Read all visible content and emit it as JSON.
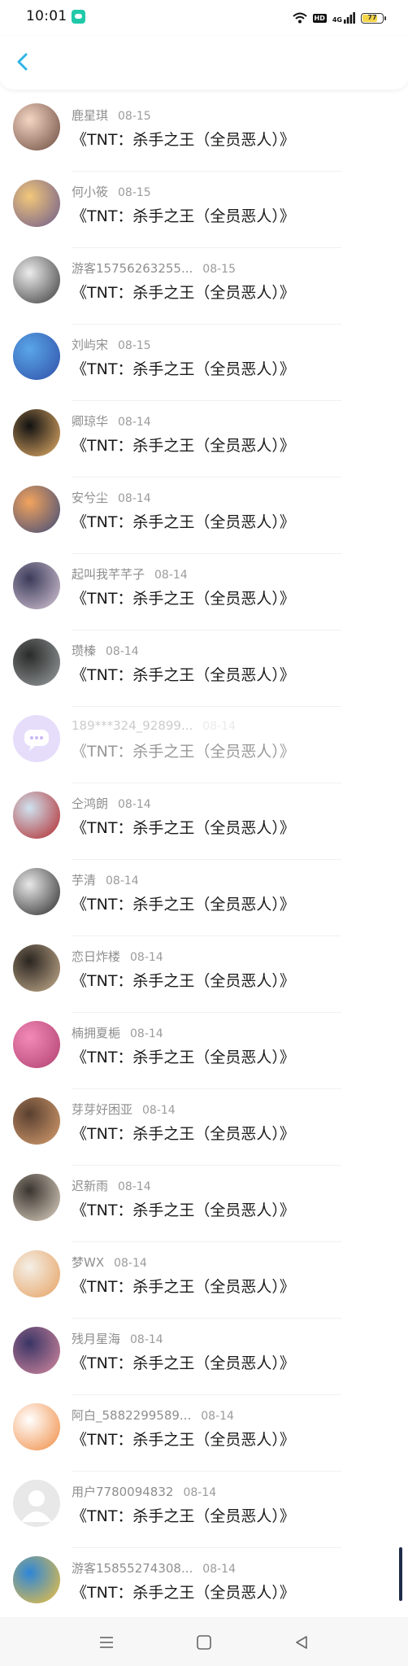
{
  "status_bar": {
    "time": "10:01",
    "hd": "HD",
    "network": "4G",
    "battery_level": "77",
    "notification_icon": "chat-bubble-icon"
  },
  "header": {
    "back_icon": "chevron-left-icon",
    "accent_color": "#2fb5e6"
  },
  "rows": [
    {
      "name": "鹿星琪",
      "date": "08-15",
      "title": "《TNT：杀手之王（全员恶人）》",
      "avatar": [
        "#f4d4c2",
        "#6b4b3e"
      ]
    },
    {
      "name": "何小筱",
      "date": "08-15",
      "title": "《TNT：杀手之王（全员恶人）》",
      "avatar": [
        "#f2c77a",
        "#6c5a8c"
      ]
    },
    {
      "name": "游客15756263255...",
      "date": "08-15",
      "title": "《TNT：杀手之王（全员恶人）》",
      "avatar": [
        "#ececec",
        "#3a3a3a"
      ]
    },
    {
      "name": "刘屿宋",
      "date": "08-15",
      "title": "《TNT：杀手之王（全员恶人）》",
      "avatar": [
        "#5aa6e8",
        "#2f4fa8"
      ]
    },
    {
      "name": "卿琼华",
      "date": "08-14",
      "title": "《TNT：杀手之王（全员恶人）》",
      "avatar": [
        "#111111",
        "#e8b16a"
      ]
    },
    {
      "name": "安兮尘",
      "date": "08-14",
      "title": "《TNT：杀手之王（全员恶人）》",
      "avatar": [
        "#f2a35c",
        "#3d4a7a"
      ]
    },
    {
      "name": "起叫我芊芊子",
      "date": "08-14",
      "title": "《TNT：杀手之王（全员恶人）》",
      "avatar": [
        "#3b3b5a",
        "#d8c8d8"
      ]
    },
    {
      "name": "瓒榛",
      "date": "08-14",
      "title": "《TNT：杀手之王（全员恶人）》",
      "avatar": [
        "#2a2a2a",
        "#9aa0a0"
      ]
    },
    {
      "name": "189***324_92899...",
      "date": "08-14",
      "title": "《TNT：杀手之王（全员恶人）》",
      "avatar": [
        "#e6ddfb",
        "#c9b8f7"
      ],
      "placeholder": true,
      "dim": true
    },
    {
      "name": "仝鸿朗",
      "date": "08-14",
      "title": "《TNT：杀手之王（全员恶人）》",
      "avatar": [
        "#cfe3ef",
        "#b2262a"
      ]
    },
    {
      "name": "芋清",
      "date": "08-14",
      "title": "《TNT：杀手之王（全员恶人）》",
      "avatar": [
        "#e8e8e8",
        "#2a2a2a"
      ]
    },
    {
      "name": "恋日炸楼",
      "date": "08-14",
      "title": "《TNT：杀手之王（全员恶人）》",
      "avatar": [
        "#2a2520",
        "#c9b090"
      ]
    },
    {
      "name": "楠拥夏梔",
      "date": "08-14",
      "title": "《TNT：杀手之王（全员恶人）》",
      "avatar": [
        "#f28ab8",
        "#b04070"
      ]
    },
    {
      "name": "芽芽好困亚",
      "date": "08-14",
      "title": "《TNT：杀手之王（全员恶人）》",
      "avatar": [
        "#5a4030",
        "#d9a070"
      ]
    },
    {
      "name": "迟新雨",
      "date": "08-14",
      "title": "《TNT：杀手之王（全员恶人）》",
      "avatar": [
        "#3a3530",
        "#e0d4c4"
      ]
    },
    {
      "name": "梦WX",
      "date": "08-14",
      "title": "《TNT：杀手之王（全员恶人）》",
      "avatar": [
        "#f4efe6",
        "#e6a060"
      ]
    },
    {
      "name": "残月星海",
      "date": "08-14",
      "title": "《TNT：杀手之王（全员恶人）》",
      "avatar": [
        "#3a3566",
        "#d88aa0"
      ]
    },
    {
      "name": "阿白_5882299589...",
      "date": "08-14",
      "title": "《TNT：杀手之王（全员恶人）》",
      "avatar": [
        "#ffffff",
        "#f08a40"
      ]
    },
    {
      "name": "用户7780094832",
      "date": "08-14",
      "title": "《TNT：杀手之王（全员恶人）》",
      "avatar": [
        "#e8e8e8",
        "#ffffff"
      ],
      "default_user": true
    },
    {
      "name": "游客15855274308...",
      "date": "08-14",
      "title": "《TNT：杀手之王（全员恶人）》",
      "avatar": [
        "#2d86d8",
        "#f5c23a"
      ]
    }
  ],
  "nav_bar": {
    "icons": [
      "menu-icon",
      "home-icon",
      "back-triangle-icon"
    ]
  }
}
